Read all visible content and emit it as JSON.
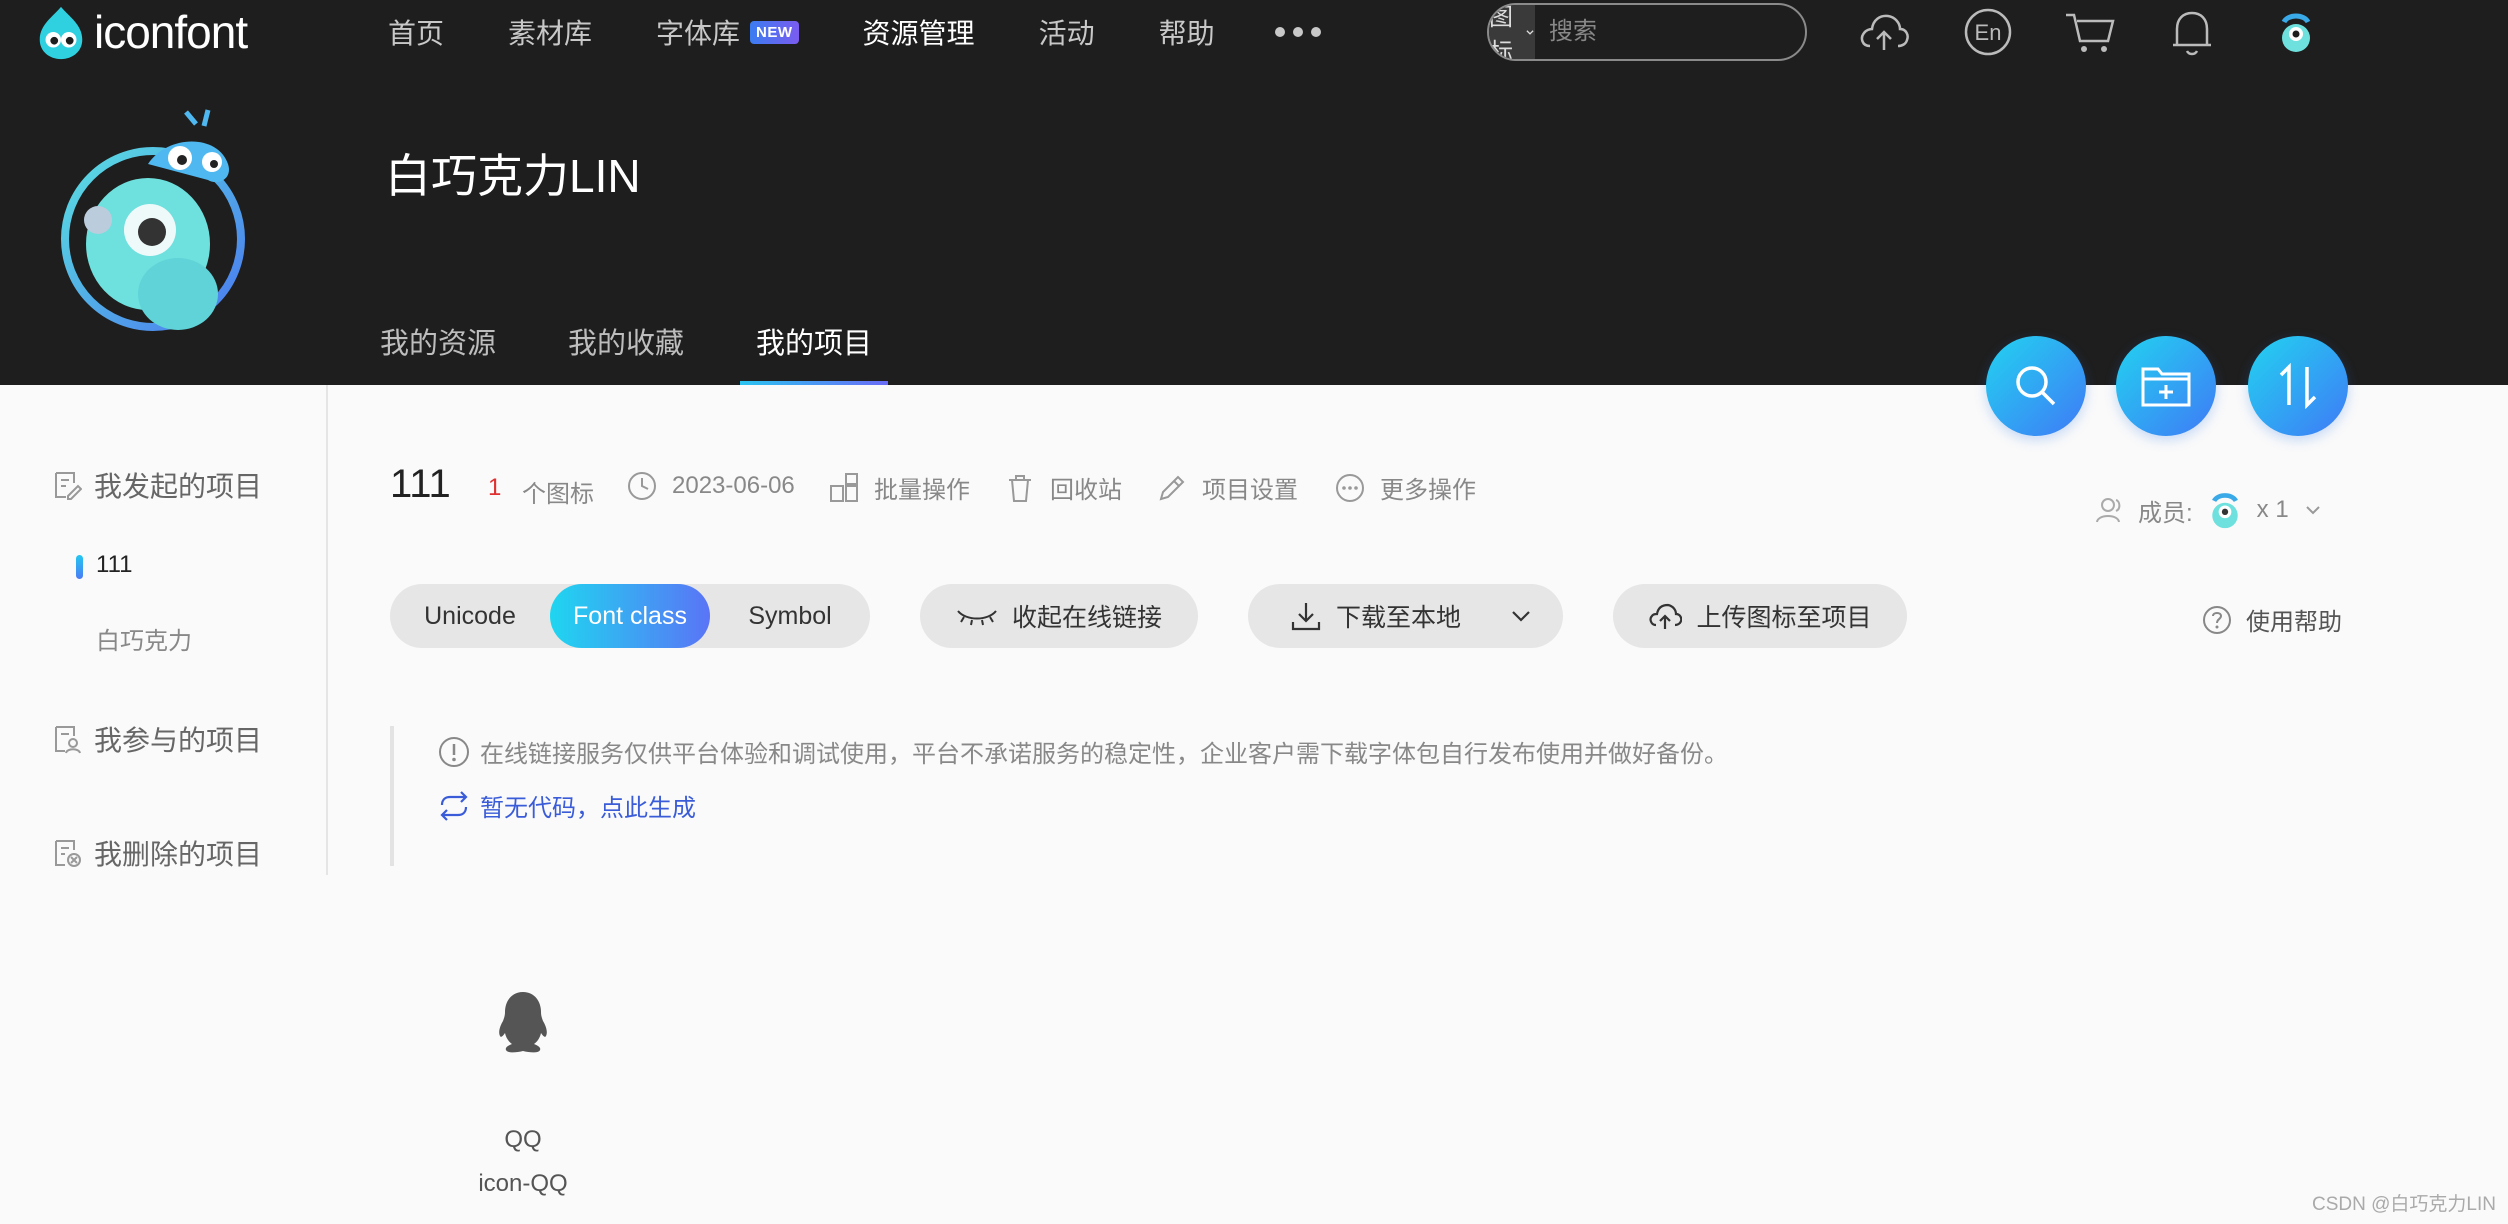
{
  "topbar": {
    "logo_text": "iconfont",
    "nav": [
      {
        "label": "首页",
        "active": false
      },
      {
        "label": "素材库",
        "active": false
      },
      {
        "label": "字体库",
        "active": false,
        "badge": "NEW"
      },
      {
        "label": "资源管理",
        "active": true
      },
      {
        "label": "活动",
        "active": false
      },
      {
        "label": "帮助",
        "active": false
      }
    ],
    "search": {
      "type_label": "图标",
      "placeholder": "搜索"
    },
    "icons": [
      "upload-cloud-icon",
      "language-en-icon",
      "cart-icon",
      "bell-icon",
      "user-avatar-icon"
    ],
    "lang_label": "En"
  },
  "profile": {
    "username": "白巧克力LIN",
    "tabs": [
      {
        "label": "我的资源",
        "active": false
      },
      {
        "label": "我的收藏",
        "active": false
      },
      {
        "label": "我的项目",
        "active": true
      }
    ]
  },
  "sidebar": {
    "groups": [
      {
        "label": "我发起的项目",
        "icon": "edit-doc-icon"
      },
      {
        "label": "我参与的项目",
        "icon": "user-doc-icon"
      },
      {
        "label": "我删除的项目",
        "icon": "delete-doc-icon"
      }
    ],
    "projects": [
      {
        "label": "111",
        "active": true
      },
      {
        "label": "白巧克力",
        "active": false
      }
    ]
  },
  "project": {
    "name": "111",
    "icon_count": "1",
    "icon_count_label": "个图标",
    "date": "2023-06-06",
    "batch_label": "批量操作",
    "trash_label": "回收站",
    "settings_label": "项目设置",
    "more_label": "更多操作",
    "members_label": "成员:",
    "members_count": "x 1"
  },
  "toolbar": {
    "formats": [
      {
        "label": "Unicode",
        "active": false
      },
      {
        "label": "Font class",
        "active": true
      },
      {
        "label": "Symbol",
        "active": false
      }
    ],
    "collapse_link_label": "收起在线链接",
    "download_label": "下载至本地",
    "upload_label": "上传图标至项目",
    "help_label": "使用帮助"
  },
  "notice": {
    "text": "在线链接服务仅供平台体验和调试使用，平台不承诺服务的稳定性，企业客户需下载字体包自行发布使用并做好备份。",
    "generate_link": "暂无代码，点此生成"
  },
  "icons": [
    {
      "name": "QQ",
      "class": "icon-QQ",
      "glyph": "qq-penguin-icon"
    }
  ],
  "watermark": "CSDN @白巧克力LIN",
  "colors": {
    "header_bg": "#1e1e1e",
    "accent_start": "#1fd6f0",
    "accent_end": "#5a74f6",
    "count_red": "#e03030",
    "link_blue": "#3a5cd8"
  }
}
